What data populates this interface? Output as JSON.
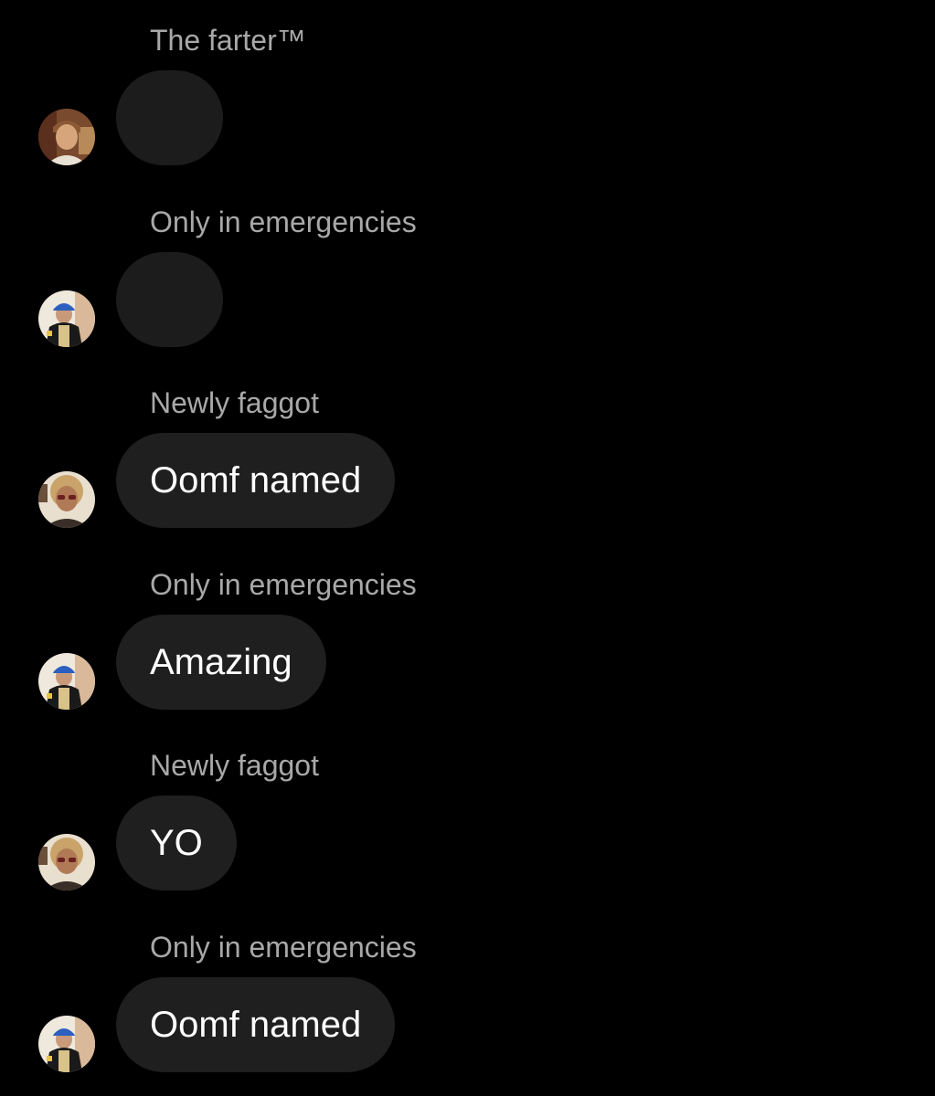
{
  "messages": [
    {
      "sender": "The farter™",
      "text": "",
      "avatar": "avatar-photo-man-brown-hair"
    },
    {
      "sender": "Only in emergencies",
      "text": "",
      "avatar": "avatar-photo-man-blue-cap"
    },
    {
      "sender": "Newly faggot",
      "text": "Oomf named",
      "avatar": "avatar-photo-man-curly-hair"
    },
    {
      "sender": "Only in emergencies",
      "text": "Amazing",
      "avatar": "avatar-photo-man-blue-cap"
    },
    {
      "sender": "Newly faggot",
      "text": "YO",
      "avatar": "avatar-photo-man-curly-hair"
    },
    {
      "sender": "Only in emergencies",
      "text": "Oomf named",
      "avatar": "avatar-photo-man-blue-cap"
    }
  ],
  "colors": {
    "background": "#000000",
    "bubble": "#1f1f1f",
    "sender_text": "#a8a8a8",
    "message_text": "#ffffff"
  }
}
